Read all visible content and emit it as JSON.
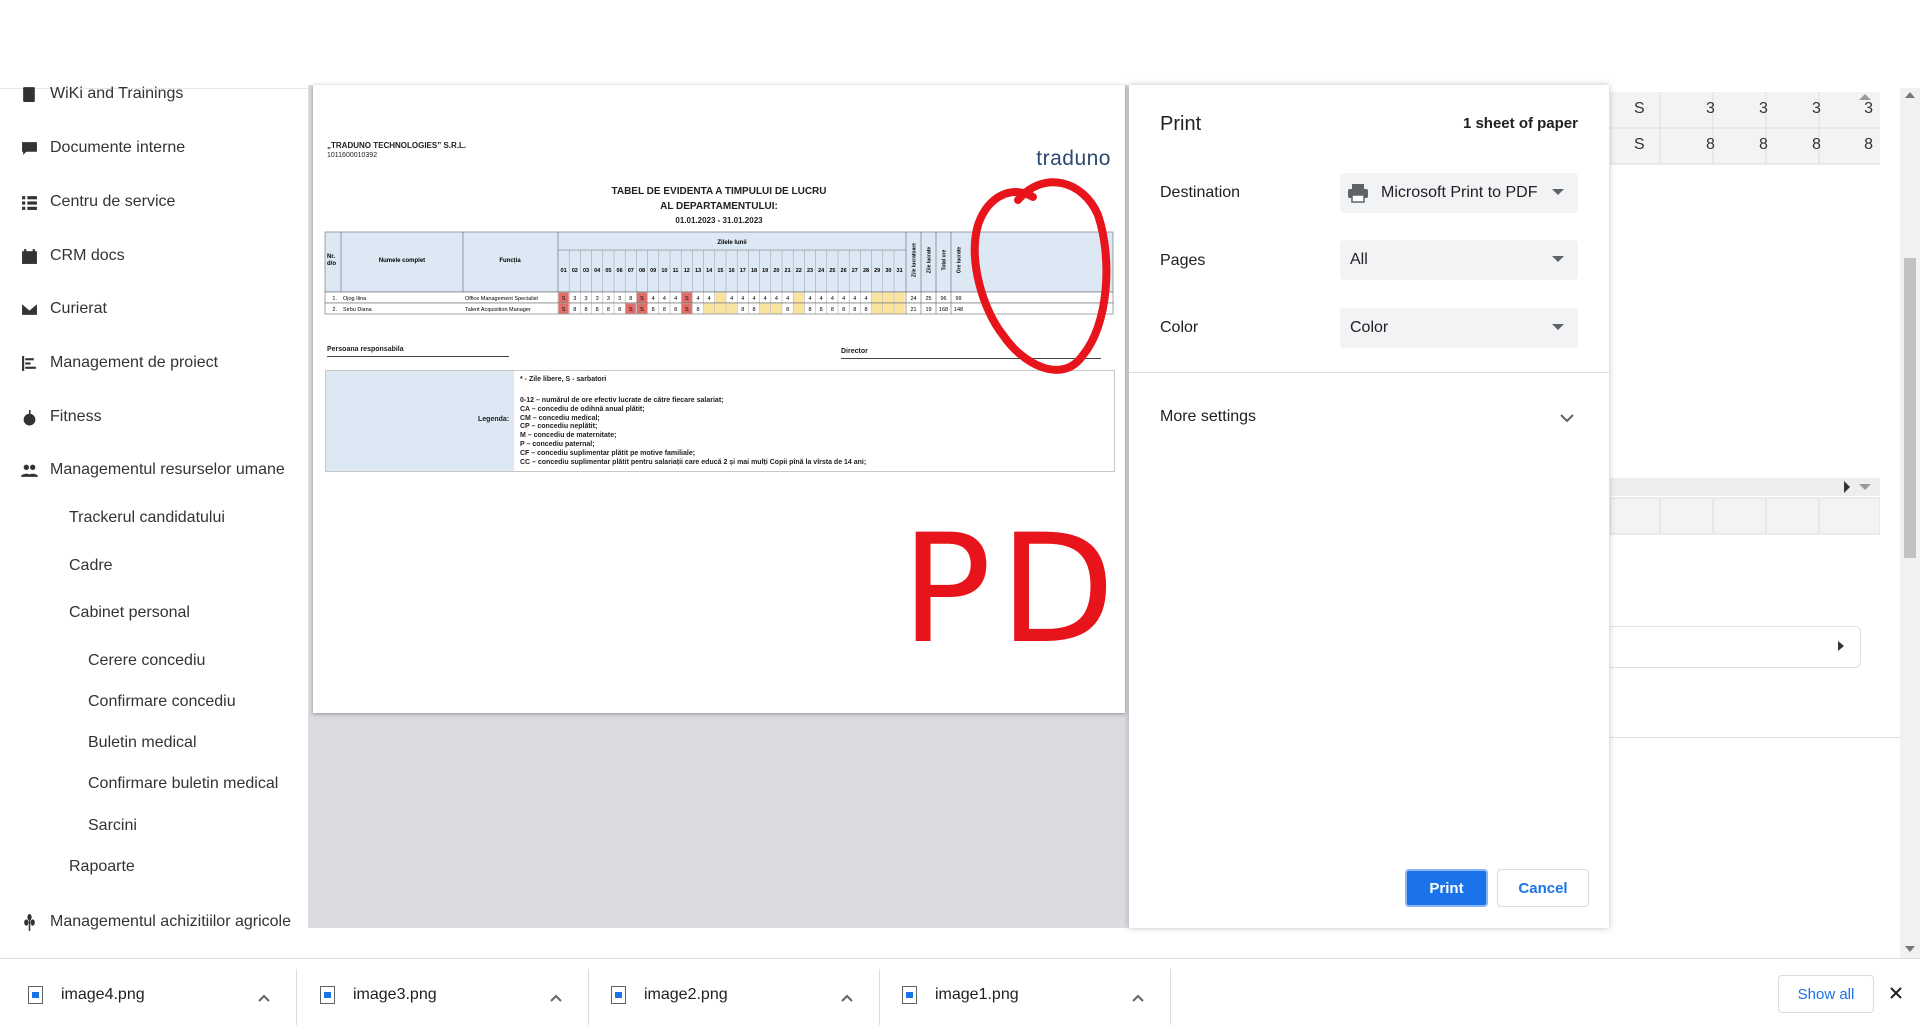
{
  "sidebar": {
    "items": [
      {
        "label": "WiKi and Trainings",
        "icon": "book-icon"
      },
      {
        "label": "Documente interne",
        "icon": "comment-icon"
      },
      {
        "label": "Centru de service",
        "icon": "list-icon"
      },
      {
        "label": "CRM docs",
        "icon": "calendar-icon"
      },
      {
        "label": "Curierat",
        "icon": "envelope-icon"
      },
      {
        "label": "Management de proiect",
        "icon": "tasks-icon"
      },
      {
        "label": "Fitness",
        "icon": "apple-icon"
      },
      {
        "label": "Managementul resurselor umane",
        "icon": "users-icon"
      }
    ],
    "hr_sub": [
      "Trackerul candidatului",
      "Cadre",
      "Cabinet personal"
    ],
    "cabinet_sub": [
      "Cerere concediu",
      "Confirmare concediu",
      "Buletin medical",
      "Confirmare buletin medical",
      "Sarcini"
    ],
    "rapoarte": "Rapoarte",
    "last": {
      "label": "Managementul achizitiilor agricole",
      "icon": "wheat-icon"
    }
  },
  "document": {
    "company": "„TRADUNO TECHNOLOGIES” S.R.L.",
    "company_code": "1011600010392",
    "logo": "traduno",
    "title1": "TABEL DE EVIDENTA A TIMPULUI DE LUCRU",
    "title2": "AL DEPARTAMENTULUI:",
    "period": "01.01.2023 - 31.01.2023",
    "headers": {
      "nr": "Nr. d/o",
      "name": "Numele complet",
      "function": "Funcția",
      "days": "Zilele lunii"
    },
    "side_headers": [
      "Zile lucratoare",
      "Zile lucrate",
      "Total ore",
      "Ore lucrate"
    ],
    "days": [
      "01",
      "02",
      "03",
      "04",
      "05",
      "06",
      "07",
      "08",
      "09",
      "10",
      "11",
      "12",
      "13",
      "14",
      "15",
      "16",
      "17",
      "18",
      "19",
      "20",
      "21",
      "22",
      "23",
      "24",
      "25",
      "26",
      "27",
      "28",
      "29",
      "30",
      "31"
    ],
    "rows": [
      {
        "nr": "1.",
        "name": "Ojog Ilina",
        "function": "Office Management Specialist",
        "values": [
          "S",
          "3",
          "3",
          "3",
          "3",
          "3",
          "8",
          "S",
          "4",
          "4",
          "4",
          "S",
          "4",
          "4",
          "",
          "4",
          "4",
          "4",
          "4",
          "4",
          "4",
          "",
          "4",
          "4",
          "4",
          "4",
          "4",
          "4",
          "",
          "",
          ""
        ],
        "totals": [
          "24",
          "25",
          "96",
          "99"
        ]
      },
      {
        "nr": "2.",
        "name": "Sirbu Diana",
        "function": "Talent Acquisition Manager",
        "values": [
          "S",
          "8",
          "8",
          "8",
          "8",
          "8",
          "S",
          "S",
          "8",
          "8",
          "8",
          "S",
          "8",
          "",
          "",
          "",
          "8",
          "8",
          "",
          "",
          "8",
          "",
          "8",
          "8",
          "8",
          "8",
          "8",
          "8",
          "",
          "",
          ""
        ],
        "totals": [
          "21",
          "19",
          "168",
          "148"
        ]
      }
    ],
    "responsible": "Persoana responsabila",
    "director": "Director",
    "legend_label": "Legenda:",
    "legend_top": "* - Zile libere, S - sarbatori",
    "legend_lines": [
      "0-12 – numărul de ore efectiv lucrate de către fiecare salariat;",
      "CA – concediu de odihnă anual plătit;",
      "CM – concediu medical;",
      "CP – concediu neplătit;",
      "M – concediu de maternitate;",
      "P – concediu paternal;",
      "CF – concediu suplimentar plătit pe motive familiale;",
      "CC – concediu suplimentar plătit pentru salariații care educă 2 și mai mulți Copii pînă la vîrsta de 14 ani;"
    ],
    "pdf_scrawl": "PDF"
  },
  "print": {
    "title": "Print",
    "sheets": "1 sheet of paper",
    "destination_label": "Destination",
    "destination_value": "Microsoft Print to PDF",
    "pages_label": "Pages",
    "pages_value": "All",
    "color_label": "Color",
    "color_value": "Color",
    "more_settings": "More settings",
    "print_btn": "Print",
    "cancel_btn": "Cancel",
    "accent": "#1a73e8"
  },
  "background_grid": {
    "row1": [
      "S",
      "3",
      "3",
      "3",
      "3"
    ],
    "row2": [
      "S",
      "8",
      "8",
      "8",
      "8"
    ]
  },
  "downloads": {
    "files": [
      "image4.png",
      "image3.png",
      "image2.png",
      "image1.png"
    ],
    "show_all": "Show all"
  }
}
